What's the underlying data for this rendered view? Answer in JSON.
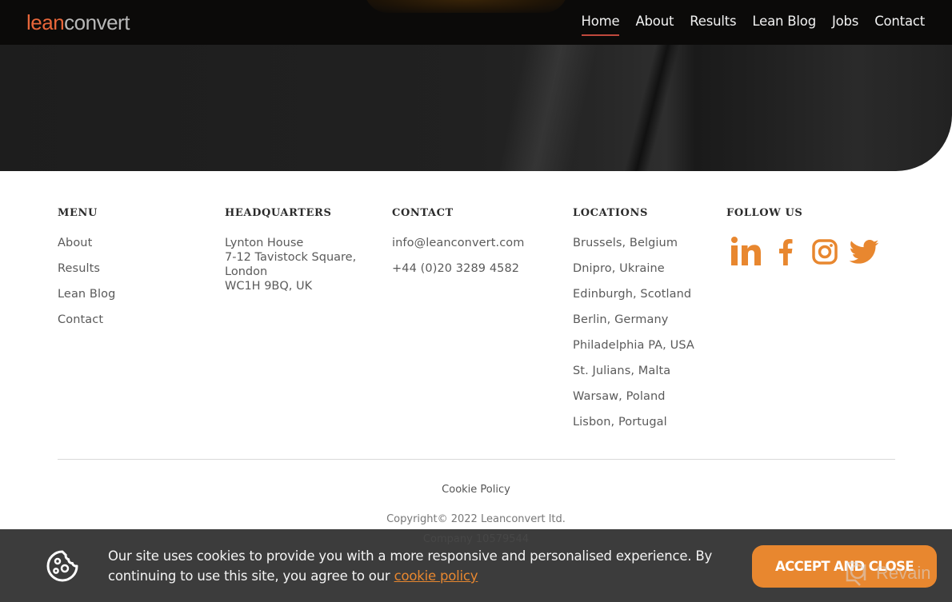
{
  "header": {
    "logo": {
      "part1": "lean",
      "part2": "convert"
    },
    "nav": [
      {
        "label": "Home",
        "active": true
      },
      {
        "label": "About"
      },
      {
        "label": "Results"
      },
      {
        "label": "Lean Blog"
      },
      {
        "label": "Jobs"
      },
      {
        "label": "Contact"
      }
    ]
  },
  "footer": {
    "menu": {
      "title": "MENU",
      "items": [
        "About",
        "Results",
        "Lean Blog",
        "Contact"
      ]
    },
    "headquarters": {
      "title": "HEADQUARTERS",
      "lines": [
        "Lynton House",
        "7-12 Tavistock Square,",
        "London",
        "WC1H 9BQ, UK"
      ]
    },
    "contact": {
      "title": "CONTACT",
      "email": "info@leanconvert.com",
      "phone": "+44 (0)20 3289 4582"
    },
    "locations": {
      "title": "LOCATIONS",
      "items": [
        "Brussels, Belgium",
        "Dnipro, Ukraine",
        "Edinburgh, Scotland",
        "Berlin, Germany",
        "Philadelphia PA, USA",
        "St. Julians, Malta",
        "Warsaw, Poland",
        "Lisbon, Portugal"
      ]
    },
    "follow": {
      "title": "FOLLOW US",
      "icons": [
        "linkedin-icon",
        "facebook-icon",
        "instagram-icon",
        "twitter-icon"
      ]
    },
    "cookie_policy_label": "Cookie Policy",
    "copyright": "Copyright© 2022 Leanconvert ltd.",
    "company": "Company 10579544"
  },
  "cookie_banner": {
    "text_before": "Our site uses cookies to provide you with a more responsive and personalised experience. By continuing to use this site, you agree to our ",
    "link_label": "cookie policy",
    "accept_label": "ACCEPT AND CLOSE"
  },
  "watermark": {
    "label": "Revain"
  },
  "colors": {
    "accent": "#e8872f",
    "logo_orange": "#e8663a",
    "nav_underline": "#c0493d",
    "banner_bg": "#3c3c3c",
    "header_bg": "#0b0a09"
  }
}
